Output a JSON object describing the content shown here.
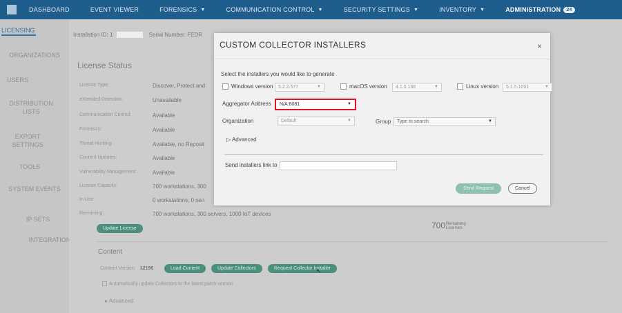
{
  "topnav": {
    "items": [
      {
        "label": "DASHBOARD"
      },
      {
        "label": "EVENT VIEWER"
      },
      {
        "label": "FORENSICS"
      },
      {
        "label": "COMMUNICATION CONTROL"
      },
      {
        "label": "SECURITY SETTINGS"
      },
      {
        "label": "INVENTORY"
      },
      {
        "label": "ADMINISTRATION",
        "badge": "24"
      }
    ]
  },
  "sidebar": {
    "items": [
      {
        "label": "LICENSING"
      },
      {
        "label": "ORGANIZATIONS"
      },
      {
        "label": "USERS"
      },
      {
        "label": "DISTRIBUTION LISTS"
      },
      {
        "label": "EXPORT SETTINGS"
      },
      {
        "label": "TOOLS"
      },
      {
        "label": "SYSTEM EVENTS"
      },
      {
        "label": "IP SETS"
      },
      {
        "label": "INTEGRATIONS"
      }
    ]
  },
  "main": {
    "installation_label": "Installation ID:",
    "installation_value": "1",
    "serial_label": "Serial Number:",
    "serial_value": "FEDR",
    "license_status_title": "License Status",
    "license_rows": [
      {
        "label": "License Type:",
        "value": "Discover, Protect and"
      },
      {
        "label": "eXtended Detection:",
        "value": "Unavailable"
      },
      {
        "label": "Communication Control:",
        "value": "Available"
      },
      {
        "label": "Forensics:",
        "value": "Available"
      },
      {
        "label": "Threat Hunting:",
        "value": "Available, no Reposit"
      },
      {
        "label": "Content Updates:",
        "value": "Available"
      },
      {
        "label": "Vulnerability Management:",
        "value": "Available"
      },
      {
        "label": "License Capacity:",
        "value": "700 workstations, 300"
      },
      {
        "label": "In Use:",
        "value": "0 workstations, 0 sen"
      },
      {
        "label": "Remaining:",
        "value": "700 workstations, 300 servers, 1000 IoT devices"
      }
    ],
    "update_license_label": "Update License",
    "remaining_count": "700",
    "remaining_word": "Remaining",
    "licenses_word": "Licenses",
    "content_title": "Content",
    "content_version_label": "Content Version:",
    "content_version_value": "12196",
    "load_content_label": "Load Content",
    "update_collectors_label": "Update Collectors",
    "request_installer_label": "Request Collector Installer",
    "auto_update_label": "Automatically update Collectors to the latest patch version",
    "advanced_label": "Advanced"
  },
  "modal": {
    "title": "CUSTOM COLLECTOR INSTALLERS",
    "close_glyph": "×",
    "instructions": "Select the installers you would like to generate",
    "windows_label": "Windows version",
    "windows_version": "5.2.2.577",
    "macos_label": "macOS version",
    "macos_version": "4.1.0.188",
    "linux_label": "Linux version",
    "linux_version": "5.1.5.1091",
    "aggregator_label": "Aggregator Address",
    "aggregator_value": "N/A:8081",
    "organization_label": "Organization",
    "organization_value": "Default",
    "group_label": "Group",
    "group_placeholder": "Type to search",
    "advanced_label": "Advanced",
    "send_link_label": "Send installers link to",
    "send_request_label": "Send Request",
    "cancel_label": "Cancel"
  },
  "colors": {
    "nav_bg": "#1f5d8c",
    "accent_green": "#4c8f7d",
    "highlight_red": "#e0102a"
  }
}
